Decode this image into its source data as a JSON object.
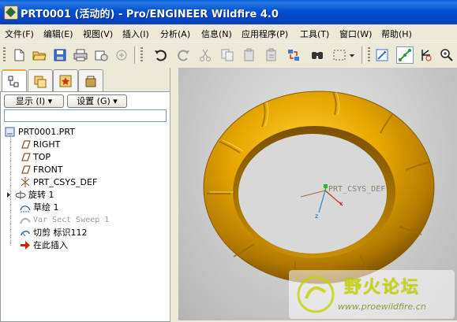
{
  "window": {
    "title": "PRT0001 (活动的) - Pro/ENGINEER Wildfire 4.0"
  },
  "menu": [
    "文件(F)",
    "编辑(E)",
    "视图(V)",
    "插入(I)",
    "分析(A)",
    "信息(N)",
    "应用程序(P)",
    "工具(T)",
    "窗口(W)",
    "帮助(H)"
  ],
  "toolbar": {
    "icons": [
      "new-icon",
      "open-icon",
      "save-icon",
      "print-icon",
      "email-icon",
      "email-attach-icon",
      "undo-icon",
      "redo-icon",
      "cut-icon",
      "copy-icon",
      "paste-icon",
      "paste-special-icon",
      "regenerate-icon",
      "find-icon",
      "select-box-icon",
      "select-dropdown-icon",
      "repaint-icon",
      "spin-center-icon",
      "orient-icon",
      "zoom-in-icon"
    ]
  },
  "model_tree": {
    "show_label": "显示 (I) ▾",
    "settings_label": "设置 (G) ▾",
    "filter_value": "",
    "items": [
      {
        "label": "PRT0001.PRT",
        "icon": "part-icon"
      },
      {
        "label": "RIGHT",
        "icon": "datum-plane-icon"
      },
      {
        "label": "TOP",
        "icon": "datum-plane-icon"
      },
      {
        "label": "FRONT",
        "icon": "datum-plane-icon"
      },
      {
        "label": "PRT_CSYS_DEF",
        "icon": "csys-icon"
      },
      {
        "label": "旋转 1",
        "icon": "revolve-icon"
      },
      {
        "label": "草绘 1",
        "icon": "sketch-icon"
      },
      {
        "label": "Var Sect Sweep 1",
        "icon": "suppressed-sweep-icon"
      },
      {
        "label": "切剪 标识112",
        "icon": "cut-feature-icon"
      },
      {
        "label": "在此插入",
        "icon": "insert-here-arrow-icon"
      }
    ]
  },
  "viewport": {
    "csys_label": "PRT_CSYS_DEF",
    "axis_x": "x",
    "axis_z": "z",
    "model_color": "#d49a00",
    "background": "#cfcfcf"
  },
  "watermark": {
    "cn_text": "野火论坛",
    "url": "www.proewildfire.cn"
  }
}
